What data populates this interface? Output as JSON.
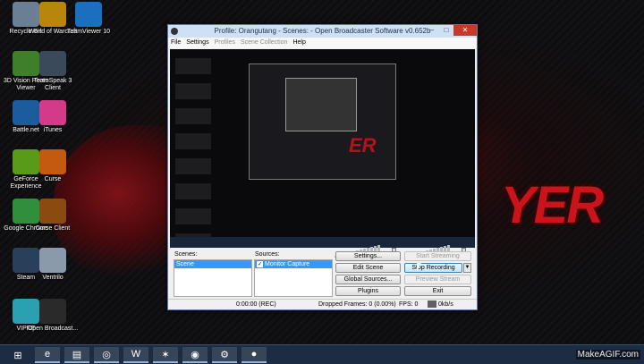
{
  "desktop": {
    "icons": [
      {
        "label": "Recycle Bin",
        "icon": "recycle-bin-icon",
        "color": "#6a7f94"
      },
      {
        "label": "World of Warcraft",
        "icon": "wow-icon",
        "color": "#b8860b"
      },
      {
        "label": "TeamViewer 10",
        "icon": "teamviewer-icon",
        "color": "#1b6fbf"
      },
      {
        "label": "3D Vision Photo Viewer",
        "icon": "3d-vision-icon",
        "color": "#3f7f2a"
      },
      {
        "label": "TeamSpeak 3 Client",
        "icon": "teamspeak-icon",
        "color": "#3a4a5a"
      },
      {
        "label": "Battle.net",
        "icon": "battlenet-icon",
        "color": "#1a5c9e"
      },
      {
        "label": "iTunes",
        "icon": "itunes-icon",
        "color": "#d43a8a"
      },
      {
        "label": "GeForce Experience",
        "icon": "geforce-icon",
        "color": "#5a9a1a"
      },
      {
        "label": "Curse",
        "icon": "curse-icon",
        "color": "#c25a10"
      },
      {
        "label": "Google Chrome",
        "icon": "chrome-icon",
        "color": "#2f8f3a"
      },
      {
        "label": "Curse Client",
        "icon": "curse-client-icon",
        "color": "#8a4a10"
      },
      {
        "label": "Steam",
        "icon": "steam-icon",
        "color": "#2a3f5a"
      },
      {
        "label": "Ventrilo",
        "icon": "ventrilo-icon",
        "color": "#8a9aaa"
      },
      {
        "label": "VIPRE",
        "icon": "vipre-icon",
        "color": "#2aa0b0"
      },
      {
        "label": "Open Broadcast...",
        "icon": "obs-icon",
        "color": "#2a2a2a"
      }
    ],
    "wallpaper_logo": "YER"
  },
  "obs": {
    "title": "Profile: Orangutang - Scenes: - Open Broadcaster Software v0.652b",
    "menu": [
      "File",
      "Settings",
      "Profiles",
      "Scene Collection",
      "Help"
    ],
    "scenes_label": "Scenes:",
    "sources_label": "Sources:",
    "scenes": [
      "Scene"
    ],
    "sources": [
      "Monitor Capture"
    ],
    "buttons": {
      "settings": "Settings...",
      "start_streaming": "Start Streaming",
      "edit_scene": "Edit Scene",
      "stop_recording": "Stop Recording",
      "global_sources": "Global Sources...",
      "preview_stream": "Preview Stream",
      "plugins": "Plugins",
      "exit": "Exit"
    },
    "status": {
      "time": "0:00:00 (REC)",
      "dropped": "Dropped Frames: 0 (0.00%)",
      "fps": "FPS: 0",
      "kbps": "0kb/s"
    },
    "preview_logo": "ER"
  },
  "taskbar": {
    "items": [
      "start-icon",
      "ie-icon",
      "explorer-icon",
      "chrome-icon",
      "wow-icon",
      "curse-icon",
      "steam-icon",
      "obs-purple-icon",
      "obs-icon"
    ]
  },
  "watermark": "MakeAGIF.com"
}
